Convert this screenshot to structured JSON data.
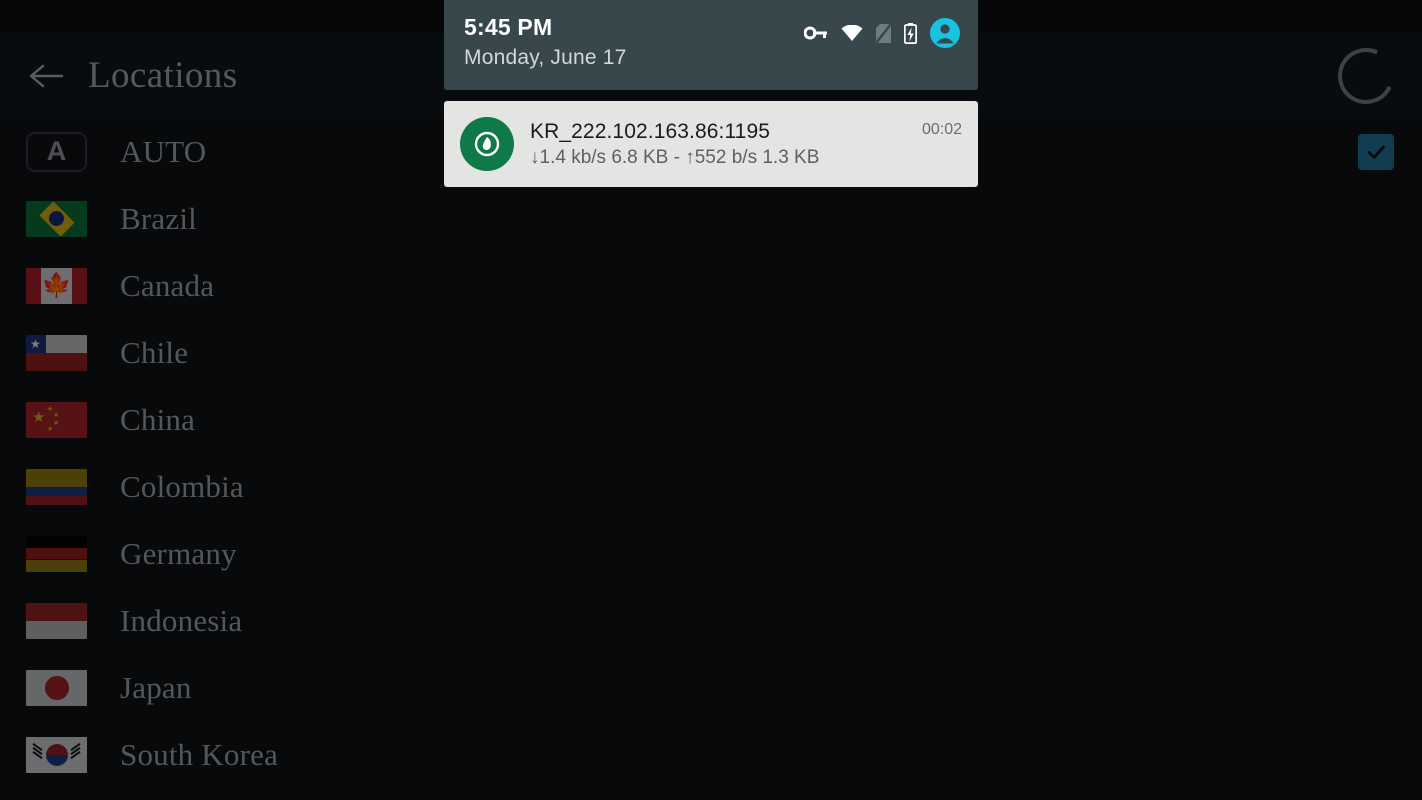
{
  "appbar": {
    "title": "Locations",
    "back_icon": "arrow-left-icon",
    "loading_icon": "spinner-icon"
  },
  "locations": {
    "items": [
      {
        "label": "AUTO",
        "icon": "auto-badge",
        "badge_letter": "A",
        "selected": true
      },
      {
        "label": "Brazil",
        "icon": "flag-brazil",
        "selected": false
      },
      {
        "label": "Canada",
        "icon": "flag-canada",
        "selected": false
      },
      {
        "label": "Chile",
        "icon": "flag-chile",
        "selected": false
      },
      {
        "label": "China",
        "icon": "flag-china",
        "selected": false
      },
      {
        "label": "Colombia",
        "icon": "flag-colombia",
        "selected": false
      },
      {
        "label": "Germany",
        "icon": "flag-germany",
        "selected": false
      },
      {
        "label": "Indonesia",
        "icon": "flag-indonesia",
        "selected": false
      },
      {
        "label": "Japan",
        "icon": "flag-japan",
        "selected": false
      },
      {
        "label": "South Korea",
        "icon": "flag-south-korea",
        "selected": false
      }
    ]
  },
  "shade": {
    "time": "5:45 PM",
    "date": "Monday, June 17",
    "status_icons": [
      "vpn-key-icon",
      "wifi-icon",
      "no-sim-icon",
      "battery-charging-icon",
      "user-avatar-icon"
    ],
    "notification": {
      "app_icon": "vpn-shield-icon",
      "title": "KR_222.102.163.86:1195",
      "subtitle": "↓1.4 kb/s 6.8 KB - ↑552 b/s 1.3 KB",
      "time": "00:02"
    }
  },
  "colors": {
    "background": "#0d0f12",
    "appbar": "#12161b",
    "text_muted": "#9a9ea2",
    "checkbox_accent": "#2f8fc4",
    "shade_header": "#37474b",
    "notif_card": "#e4e4e2",
    "notif_icon": "#0d7a47",
    "avatar": "#17c3de"
  }
}
